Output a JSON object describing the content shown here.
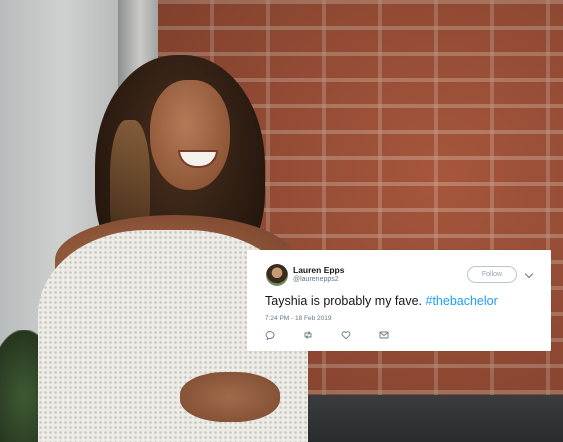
{
  "tweet": {
    "author_name": "Lauren Epps",
    "author_handle": "@laurenepps2",
    "follow_label": "Follow",
    "text": "Tayshia is probably my fave.",
    "hashtag": "#thebachelor",
    "timestamp": "7:24 PM - 18 Feb 2019",
    "icons": [
      "reply-icon",
      "retweet-icon",
      "like-icon",
      "message-icon"
    ],
    "colors": {
      "hashtag": "#1da1f2",
      "secondary_text": "#657786",
      "primary_text": "#14171a"
    }
  }
}
